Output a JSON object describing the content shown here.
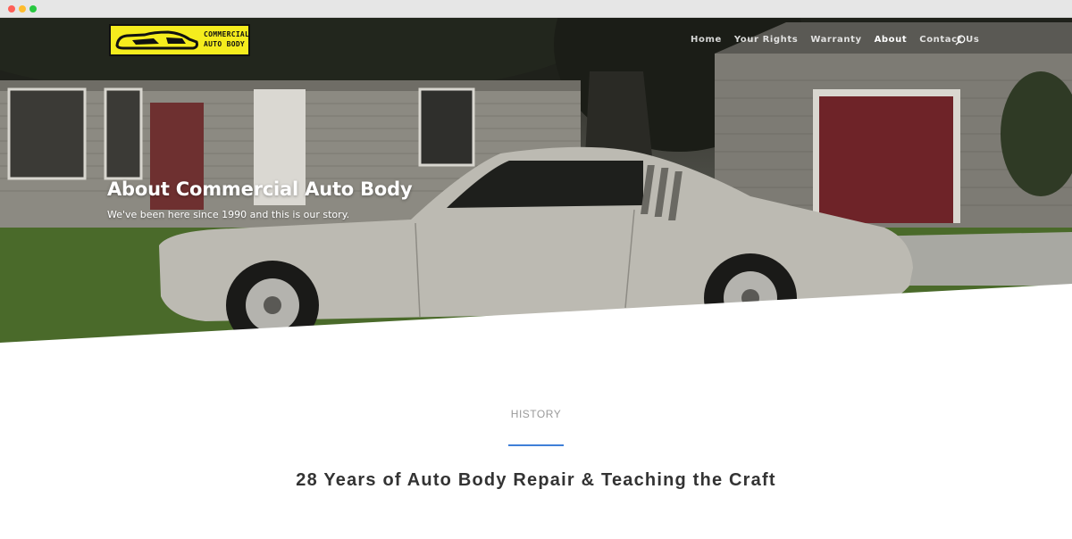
{
  "logo": {
    "text_line1": "COMMERCIAL",
    "text_line2": "AUTO BODY"
  },
  "nav": {
    "items": [
      {
        "label": "Home",
        "active": false
      },
      {
        "label": "Your Rights",
        "active": false
      },
      {
        "label": "Warranty",
        "active": false
      },
      {
        "label": "About",
        "active": true
      },
      {
        "label": "Contact Us",
        "active": false
      }
    ],
    "search_icon": "search-icon"
  },
  "hero": {
    "title": "About Commercial Auto Body",
    "subtitle": "We've been here since 1990 and this is our story."
  },
  "section": {
    "label": "HISTORY",
    "heading": "28 Years of Auto Body Repair & Teaching the Craft"
  },
  "colors": {
    "accent": "#3f7fd8",
    "logo_bg": "#f5ec1d",
    "nav_text": "#ffffff",
    "heading_text": "#333333",
    "label_text": "#9a9a9a"
  }
}
